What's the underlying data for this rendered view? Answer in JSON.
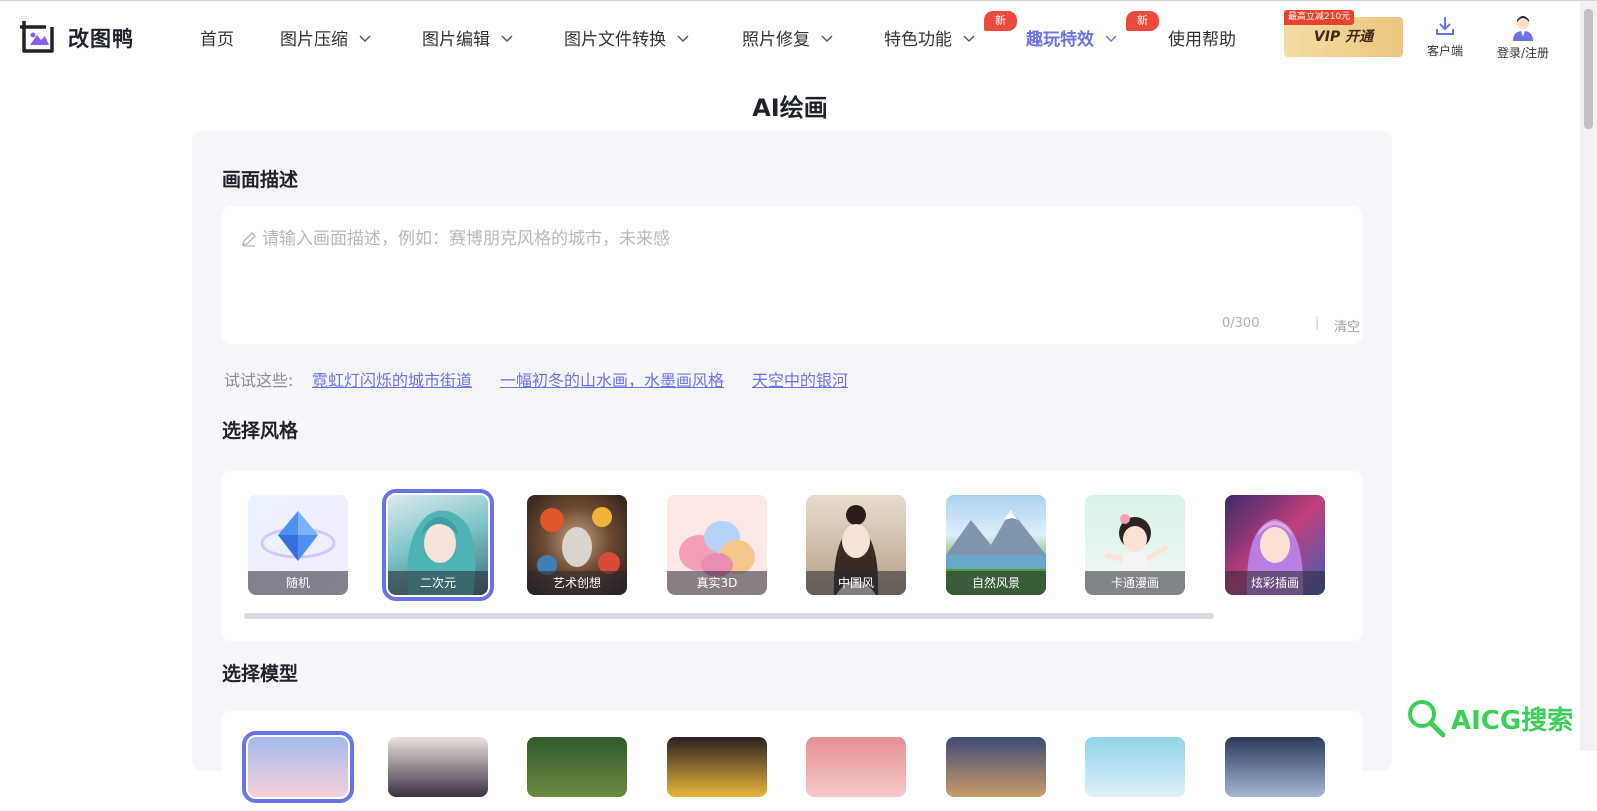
{
  "brand": {
    "name": "改图鸭"
  },
  "nav": {
    "items": [
      {
        "label": "首页",
        "dropdown": false
      },
      {
        "label": "图片压缩",
        "dropdown": true
      },
      {
        "label": "图片编辑",
        "dropdown": true
      },
      {
        "label": "图片文件转换",
        "dropdown": true
      },
      {
        "label": "照片修复",
        "dropdown": true
      },
      {
        "label": "特色功能",
        "dropdown": true,
        "badge": "新"
      },
      {
        "label": "趣玩特效",
        "dropdown": true,
        "badge": "新",
        "active": true
      },
      {
        "label": "使用帮助",
        "dropdown": false
      }
    ],
    "vip_label": "VIP 开通",
    "vip_tag": "最高立减210元",
    "client_label": "客户端",
    "login_label": "登录/注册"
  },
  "page": {
    "title": "AI绘画"
  },
  "description": {
    "title": "画面描述",
    "placeholder": "请输入画面描述，例如：赛博朋克风格的城市，未来感",
    "counter": "0/300",
    "clear_label": "清空"
  },
  "try": {
    "label": "试试这些:",
    "examples": [
      "霓虹灯闪烁的城市街道",
      "一幅初冬的山水画，水墨画风格",
      "天空中的银河"
    ]
  },
  "styles": {
    "title": "选择风格",
    "selected": "二次元",
    "items": [
      {
        "label": "随机",
        "icon": "diamond-icon"
      },
      {
        "label": "二次元"
      },
      {
        "label": "艺术创想"
      },
      {
        "label": "真实3D"
      },
      {
        "label": "中国风"
      },
      {
        "label": "自然风景"
      },
      {
        "label": "卡通漫画"
      },
      {
        "label": "炫彩插画"
      }
    ]
  },
  "models": {
    "title": "选择模型"
  },
  "watermark": {
    "text": "AICG搜索"
  },
  "colors": {
    "accent": "#6a72e8",
    "badge": "#ec4a3c",
    "vip": "#ecc57e",
    "watermark": "#3bcf5a"
  }
}
